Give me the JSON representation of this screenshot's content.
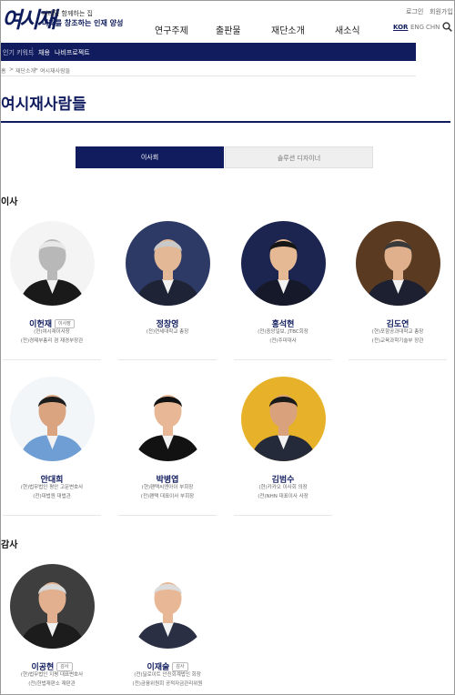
{
  "header": {
    "logo_mark": "여시재",
    "logo_sub": "시대와 함께하는 집",
    "logo_main": "미래를 창조하는 인재 양성",
    "nav": [
      "연구주제",
      "출판물",
      "재단소개",
      "새소식"
    ],
    "util": [
      "로그인",
      "회원가입"
    ],
    "lang": [
      "KOR",
      "ENG",
      "CHN"
    ],
    "active_lang": "KOR"
  },
  "keyword_bar": {
    "label": "인기 키워드",
    "items": [
      "채용",
      "나비프로젝트"
    ]
  },
  "breadcrumb": [
    "홈",
    ">",
    "재단소개",
    ">",
    "여시재사람들"
  ],
  "page_title": "여시재사람들",
  "tabs": [
    {
      "label": "이사회",
      "active": true
    },
    {
      "label": "솔루션 디자이너",
      "active": false
    }
  ],
  "sections": {
    "directors": "이사",
    "auditors": "감사"
  },
  "directors": [
    {
      "name": "이헌재",
      "badge": "이사장",
      "lines": [
        "(현)여시재이사장",
        "(전)경제부총리 겸 재경부장관"
      ],
      "bg": "#f4f4f4",
      "skin": "#b8b8b8",
      "suit": "#1a1a1a",
      "hair": "#e8e8e8",
      "mono": true
    },
    {
      "name": "정창영",
      "badge": "",
      "lines": [
        "(전)연세대학교 총장"
      ],
      "bg": "#2d3a66",
      "skin": "#e3b896",
      "suit": "#1e2435",
      "hair": "#c9c9c9",
      "mono": false
    },
    {
      "name": "홍석현",
      "badge": "",
      "lines": [
        "(전)중앙일보, JTBC회장",
        "(전)주미대사"
      ],
      "bg": "#1b2550",
      "skin": "#e6b995",
      "suit": "#15192a",
      "hair": "#161616",
      "mono": false
    },
    {
      "name": "김도연",
      "badge": "",
      "lines": [
        "(현)포항공과대학교 총장",
        "(전)교육과학기술부 장관"
      ],
      "bg": "#5a3b22",
      "skin": "#e0b08c",
      "suit": "#1c2030",
      "hair": "#3a3a3a",
      "mono": false
    },
    {
      "name": "안대희",
      "badge": "",
      "lines": [
        "(현)법무법인 평안 고문변호사",
        "(전)대법원 대법관"
      ],
      "bg": "#f3f6f8",
      "skin": "#d9a47f",
      "suit": "#6f9ed4",
      "hair": "#1c1c1c",
      "mono": false
    },
    {
      "name": "박병엽",
      "badge": "",
      "lines": [
        "(현)팬택씨앤아이 부회장",
        "(전)팬택 대표이사 부회장"
      ],
      "bg": "#ffffff",
      "skin": "#e8b896",
      "suit": "#121212",
      "hair": "#121212",
      "mono": false
    },
    {
      "name": "김범수",
      "badge": "",
      "lines": [
        "(현)카카오 이사회 의장",
        "(전)NHN 대표이사 사장"
      ],
      "bg": "#e7b22a",
      "skin": "#d9a27d",
      "suit": "#252a3a",
      "hair": "#1a1a1a",
      "mono": false
    }
  ],
  "auditors": [
    {
      "name": "이공현",
      "badge": "감사",
      "lines": [
        "(현)법무법인 지평 대표변호사",
        "(전)헌법재판소 재판관"
      ],
      "bg": "#3e3e3e",
      "skin": "#e2b08e",
      "suit": "#1c1c1c",
      "hair": "#d8d8d8",
      "mono": false
    },
    {
      "name": "이재술",
      "badge": "감사",
      "lines": [
        "(전)딜로이트 안진회계법인 회장",
        "(전)금융위원회 공적자금관리위원"
      ],
      "bg": "#ffffff",
      "skin": "#e8b896",
      "suit": "#2a2f44",
      "hair": "#dcdcdc",
      "mono": false
    }
  ],
  "colors": {
    "brand_navy": "#101c5e",
    "tab_inactive": "#efefef",
    "badge_border": "#bbbbbb"
  },
  "icons": [
    "search-icon"
  ]
}
